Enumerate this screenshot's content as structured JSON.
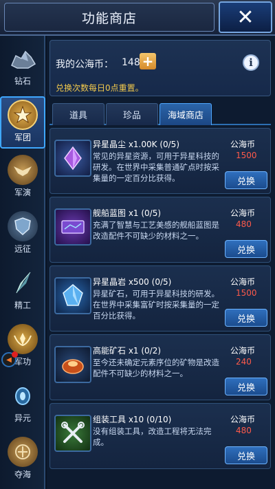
{
  "header": {
    "title": "功能商店",
    "close_label": "✕"
  },
  "sidebar": {
    "items": [
      {
        "label": "钻石",
        "icon": "diamond-ore-icon"
      },
      {
        "label": "军团",
        "icon": "legion-star-badge-icon"
      },
      {
        "label": "军演",
        "icon": "eagle-emblem-icon"
      },
      {
        "label": "远征",
        "icon": "shield-emblem-icon"
      },
      {
        "label": "精工",
        "icon": "crystal-shard-icon"
      },
      {
        "label": "军功",
        "icon": "laurel-medal-icon"
      },
      {
        "label": "异元",
        "icon": "dimension-portal-icon"
      },
      {
        "label": "夺海",
        "icon": "sea-emblem-icon"
      }
    ],
    "active_index": 1
  },
  "currency": {
    "label": "我的公海币：",
    "amount": "148",
    "plus_label": "+",
    "reset_note": "兑换次数每日0点重置。"
  },
  "tabs": [
    {
      "label": "道具"
    },
    {
      "label": "珍品"
    },
    {
      "label": "海域商店"
    }
  ],
  "active_tab": 2,
  "items": [
    {
      "name": "异星晶尘 x1.00K (0/5)",
      "desc": "常见的异星资源，可用于异星科技的研发。在世界中采集普通矿点时按采集量的一定百分比获得。",
      "currency": "公海币",
      "price": "1500",
      "buy_label": "兑换",
      "icon": "purple-crystal-dust-icon"
    },
    {
      "name": "舰船蓝图 x1 (0/5)",
      "desc": "充满了智慧与工艺美感的舰船蓝图是改造配件不可缺少的材料之一。",
      "currency": "公海币",
      "price": "480",
      "buy_label": "兑换",
      "icon": "ship-blueprint-icon"
    },
    {
      "name": "异星晶岩 x500 (0/5)",
      "desc": "异星矿石，可用于异星科技的研发。在世界中采集富矿时按采集量的一定百分比获得。",
      "currency": "公海币",
      "price": "1500",
      "buy_label": "兑换",
      "icon": "blue-crystal-rock-icon"
    },
    {
      "name": "高能矿石 x1 (0/2)",
      "desc": "至今还未确定元素序位的矿物是改造配件不可缺少的材料之一。",
      "currency": "公海币",
      "price": "240",
      "buy_label": "兑换",
      "icon": "high-energy-ore-icon"
    },
    {
      "name": "组装工具 x10 (0/10)",
      "desc": "没有组装工具，改造工程将无法完成。",
      "currency": "公海币",
      "price": "480",
      "buy_label": "兑换",
      "icon": "assembly-tools-icon"
    }
  ]
}
